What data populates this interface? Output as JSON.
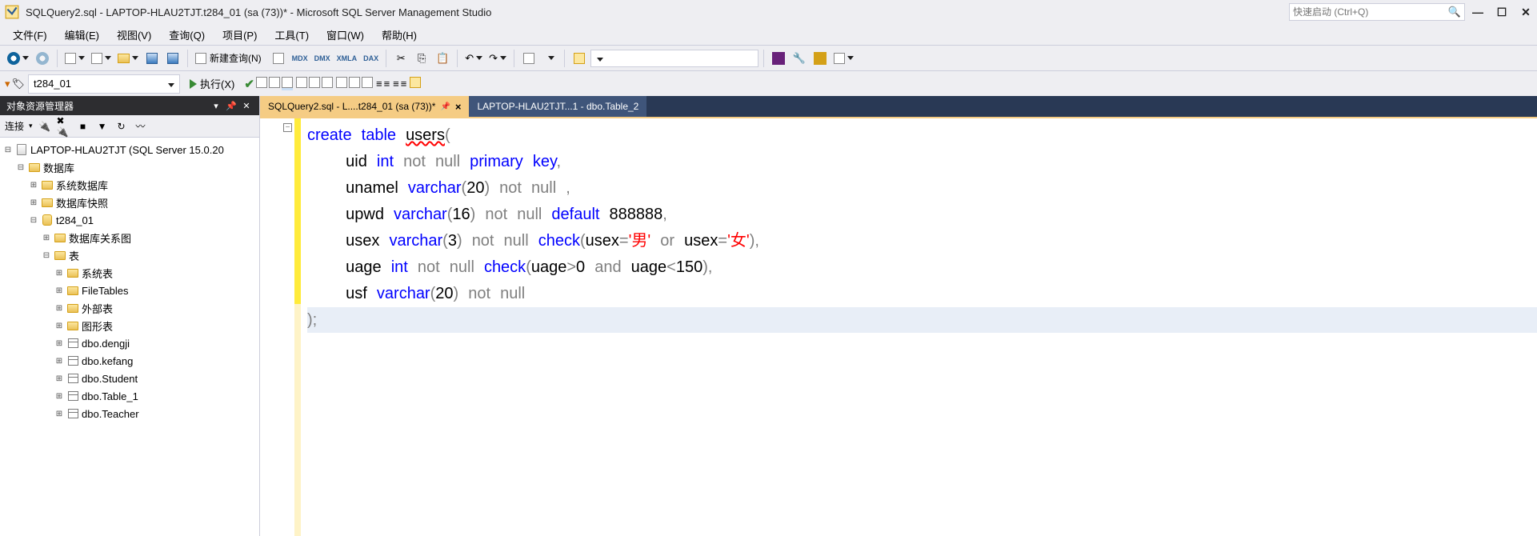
{
  "title": "SQLQuery2.sql - LAPTOP-HLAU2TJT.t284_01 (sa (73))* - Microsoft SQL Server Management Studio",
  "quicklaunch_placeholder": "快速启动 (Ctrl+Q)",
  "menu": {
    "file": "文件(F)",
    "edit": "编辑(E)",
    "view": "视图(V)",
    "query": "查询(Q)",
    "project": "项目(P)",
    "tools": "工具(T)",
    "window": "窗口(W)",
    "help": "帮助(H)"
  },
  "toolbar": {
    "new_query": "新建查询(N)",
    "mdx": "MDX",
    "dmx": "DMX",
    "xmla": "XMLA",
    "dax": "DAX"
  },
  "toolbar2": {
    "db_selected": "t284_01",
    "execute": "执行(X)"
  },
  "object_explorer": {
    "title": "对象资源管理器",
    "connect": "连接",
    "server": "LAPTOP-HLAU2TJT (SQL Server 15.0.20",
    "databases": "数据库",
    "sys_db": "系统数据库",
    "db_snapshot": "数据库快照",
    "db_name": "t284_01",
    "db_diagram": "数据库关系图",
    "tables": "表",
    "sys_tables": "系统表",
    "file_tables": "FileTables",
    "ext_tables": "外部表",
    "graph_tables": "图形表",
    "t1": "dbo.dengji",
    "t2": "dbo.kefang",
    "t3": "dbo.Student",
    "t4": "dbo.Table_1",
    "t5": "dbo.Teacher"
  },
  "tabs": {
    "active": "SQLQuery2.sql - L....t284_01 (sa (73))*",
    "inactive": "LAPTOP-HLAU2TJT...1 - dbo.Table_2"
  },
  "code": {
    "l1_a": "create",
    "l1_b": "table",
    "l1_c": "users",
    "l1_d": "(",
    "l2_a": "uid",
    "l2_b": "int",
    "l2_c": "not",
    "l2_d": "null",
    "l2_e": "primary",
    "l2_f": "key",
    "l2_g": ",",
    "l3_a": "unamel",
    "l3_b": "varchar",
    "l3_c": "(",
    "l3_d": "20",
    "l3_e": ")",
    "l3_f": "not",
    "l3_g": "null",
    "l3_h": ",",
    "l4_a": "upwd",
    "l4_b": "varchar",
    "l4_c": "(",
    "l4_d": "16",
    "l4_e": ")",
    "l4_f": "not",
    "l4_g": "null",
    "l4_h": "default",
    "l4_i": "888888",
    "l4_j": ",",
    "l5_a": "usex",
    "l5_b": "varchar",
    "l5_c": "(",
    "l5_d": "3",
    "l5_e": ")",
    "l5_f": "not",
    "l5_g": "null",
    "l5_h": "check",
    "l5_i": "(",
    "l5_j": "usex",
    "l5_k": "=",
    "l5_l": "'男'",
    "l5_m": "or",
    "l5_n": "usex",
    "l5_o": "=",
    "l5_p": "'女'",
    "l5_q": "),",
    "l6_a": "uage",
    "l6_b": "int",
    "l6_c": "not",
    "l6_d": "null",
    "l6_e": "check",
    "l6_f": "(",
    "l6_g": "uage",
    "l6_h": ">",
    "l6_i": "0",
    "l6_j": "and",
    "l6_k": "uage",
    "l6_l": "<",
    "l6_m": "150",
    "l6_n": "),",
    "l7_a": "usf",
    "l7_b": "varchar",
    "l7_c": "(",
    "l7_d": "20",
    "l7_e": ")",
    "l7_f": "not",
    "l7_g": "null",
    "l8_a": ");"
  }
}
